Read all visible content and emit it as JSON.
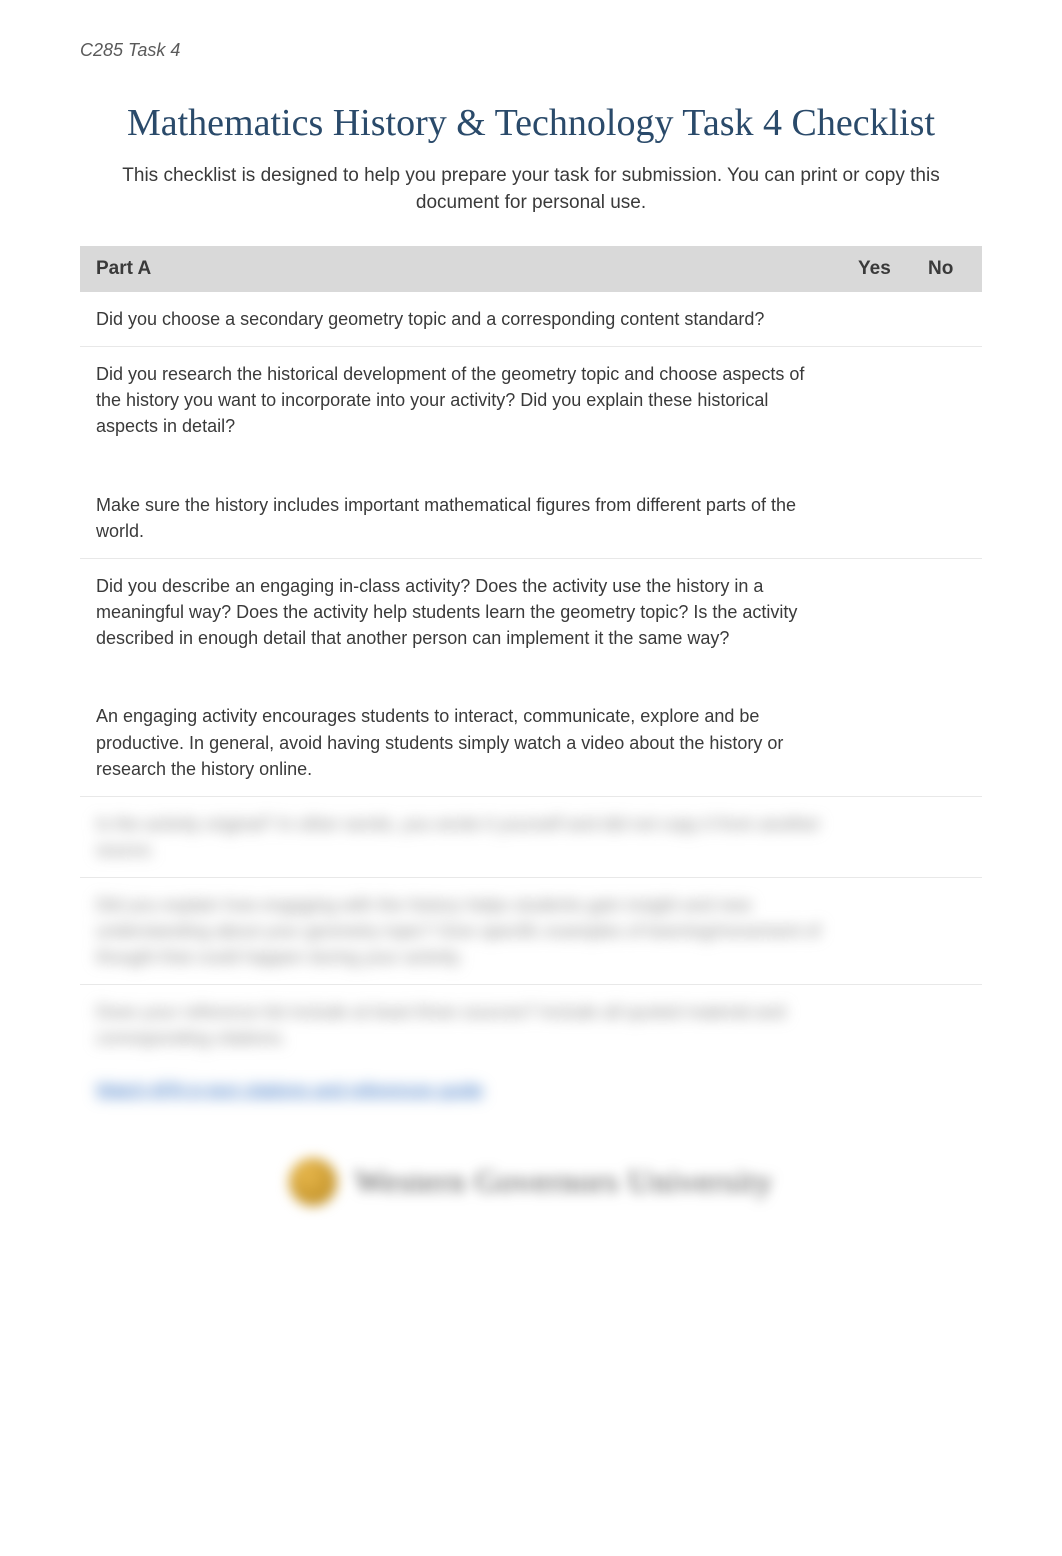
{
  "header": {
    "course": "C285 Task 4"
  },
  "title": "Mathematics History & Technology Task 4 Checklist",
  "subtitle": "This checklist is designed to help you prepare your task for submission.  You can print or copy this document for personal use.",
  "table": {
    "heading": "Part A",
    "yes": "Yes",
    "no": "No",
    "rows": [
      {
        "text": "Did you choose a secondary geometry topic and a corresponding content standard?"
      },
      {
        "text": "Did you research the historical development of the geometry topic and choose aspects of the history you want to incorporate into your activity? Did you explain these historical aspects in detail?\n\n\nMake sure the history includes important mathematical figures from different parts of the world."
      },
      {
        "text": "Did you describe an engaging in-class activity?  Does the activity use the history in a meaningful way?  Does the activity help students learn the geometry topic?  Is the activity described in enough detail that another person can implement it the same way?\n\n\nAn engaging activity encourages students to interact, communicate, explore and be productive.   In general, avoid having students simply watch a video about the history or research the history online."
      },
      {
        "blurred": true,
        "text": "Is the activity original?  In other words, you wrote it yourself and did not copy it from another source."
      },
      {
        "blurred": true,
        "text": "Did you explain how engaging with the history helps students gain insight and new understanding about your geometry topic?  Give specific examples of learning/movement of thought that could happen during your activity."
      },
      {
        "blurred": true,
        "text": "Does your reference list include at least three sources? Include all quoted material and corresponding citations.",
        "link": "Watch APA in-text citations and references guide"
      }
    ]
  },
  "footer": {
    "university": "Western Governors University"
  }
}
